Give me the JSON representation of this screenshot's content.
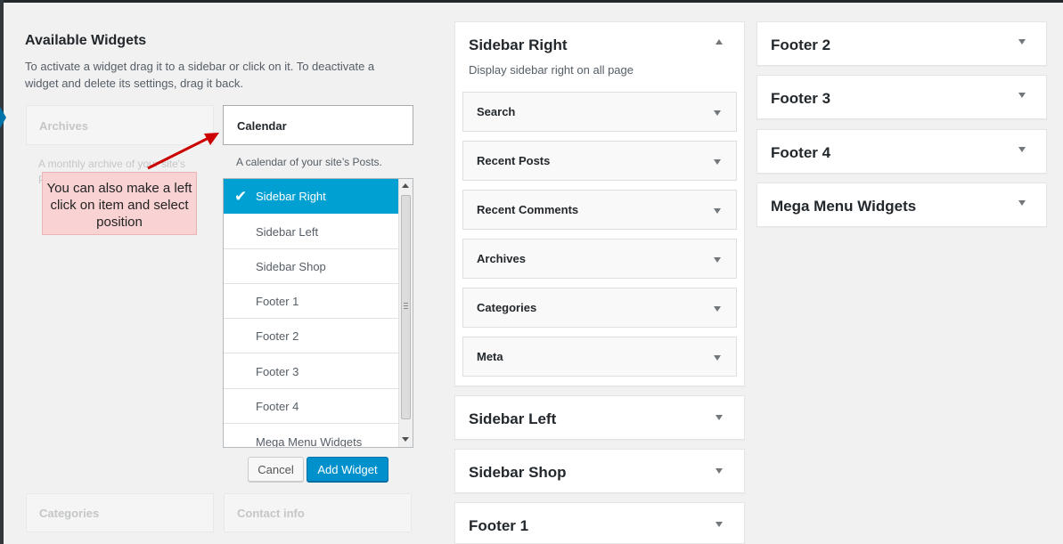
{
  "available": {
    "title": "Available Widgets",
    "description": "To activate a widget drag it to a sidebar or click on it. To deactivate a widget and delete its settings, drag it back.",
    "ghost_widgets": [
      {
        "title": "Archives",
        "desc": "A monthly archive of your site's Posts."
      },
      {
        "title": "Categories"
      },
      {
        "title": "Contact info"
      }
    ],
    "selected_widget": {
      "title": "Calendar",
      "description": "A calendar of your site’s Posts."
    },
    "chooser_items": [
      {
        "label": "Sidebar Right",
        "selected": true
      },
      {
        "label": "Sidebar Left"
      },
      {
        "label": "Sidebar Shop"
      },
      {
        "label": "Footer 1"
      },
      {
        "label": "Footer 2"
      },
      {
        "label": "Footer 3"
      },
      {
        "label": "Footer 4"
      },
      {
        "label": "Mega Menu Widgets"
      }
    ],
    "cancel_label": "Cancel",
    "add_label": "Add Widget"
  },
  "callout": {
    "text": "You can also make a left click on item and select position"
  },
  "sidebar_right": {
    "title": "Sidebar Right",
    "description": "Display sidebar right on all page",
    "widgets": [
      "Search",
      "Recent Posts",
      "Recent Comments",
      "Archives",
      "Categories",
      "Meta"
    ]
  },
  "collapsed_left": [
    "Sidebar Left",
    "Sidebar Shop",
    "Footer 1"
  ],
  "collapsed_right": [
    "Footer 2",
    "Footer 3",
    "Footer 4",
    "Mega Menu Widgets"
  ],
  "colors": {
    "accent": "#00a0d2",
    "button_primary": "#0091cd",
    "callout_bg": "#f9d3d3",
    "arrow": "#cc0000"
  },
  "icons": {
    "check": "✔",
    "toggle": "triangle"
  }
}
